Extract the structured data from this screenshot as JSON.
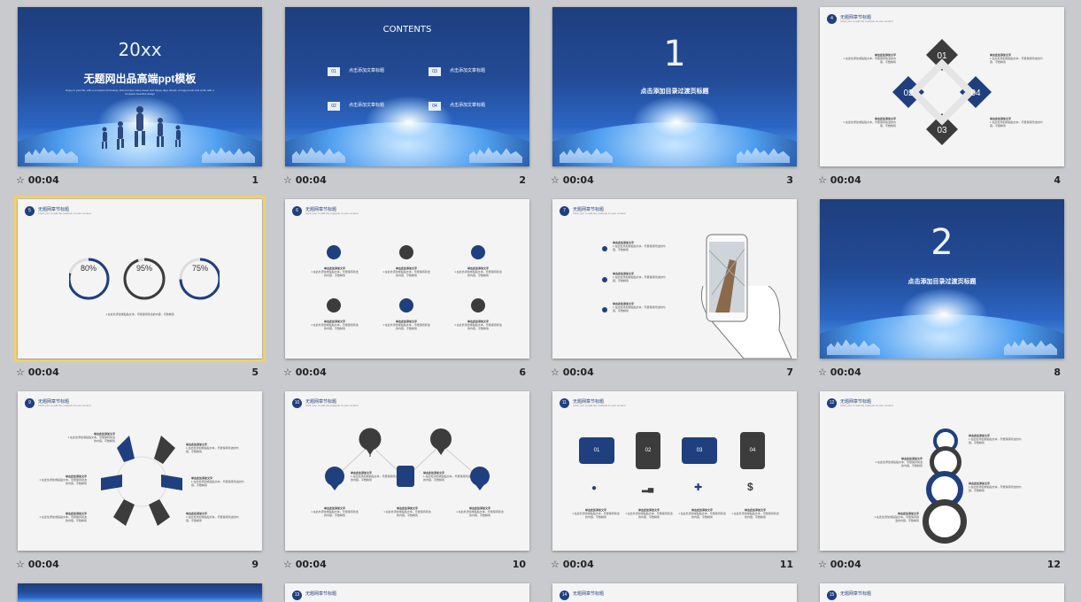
{
  "slides": [
    {
      "number": "1",
      "duration": "00:04",
      "year": "20xx",
      "title": "无题网出品高端ppt模板",
      "body": "Enjoy in your life, with a complete full beauty, that promise many sweet and happy days ahead, a happy heart and smile with a complete beautiful design"
    },
    {
      "number": "2",
      "duration": "00:04",
      "title": "CONTENTS",
      "items": [
        {
          "num": "01",
          "label": "点击添加文章标题"
        },
        {
          "num": "02",
          "label": "点击添加文章标题"
        },
        {
          "num": "03",
          "label": "点击添加文章标题"
        },
        {
          "num": "04",
          "label": "点击添加文章标题"
        }
      ]
    },
    {
      "number": "3",
      "duration": "00:04",
      "big": "1",
      "title": "点击添加目录过渡页标题"
    },
    {
      "number": "4",
      "duration": "00:04",
      "header": "无题网章节标题",
      "labels": [
        "01",
        "02",
        "03",
        "04"
      ]
    },
    {
      "number": "5",
      "duration": "00:04",
      "header": "无题网章节标题",
      "pct": [
        "80%",
        "95%",
        "75%"
      ]
    },
    {
      "number": "6",
      "duration": "00:04",
      "header": "无题网章节标题"
    },
    {
      "number": "7",
      "duration": "00:04",
      "header": "无题网章节标题"
    },
    {
      "number": "8",
      "duration": "00:04",
      "big": "2",
      "title": "点击添加目录过渡页标题"
    },
    {
      "number": "9",
      "duration": "00:04",
      "header": "无题网章节标题"
    },
    {
      "number": "10",
      "duration": "00:04",
      "header": "无题网章节标题"
    },
    {
      "number": "11",
      "duration": "00:04",
      "header": "无题网章节标题",
      "pieces": [
        "01",
        "02",
        "03",
        "04"
      ],
      "currency": "$"
    },
    {
      "number": "12",
      "duration": "00:04",
      "header": "无题网章节标题"
    },
    {
      "number": "13"
    },
    {
      "number": "14",
      "header": "无题网章节标题"
    },
    {
      "number": "15",
      "header": "无题网章节标题"
    },
    {
      "number": "16",
      "header": "无题网章节标题"
    }
  ],
  "common": {
    "sublabel": "Click your to add the analysis of your content",
    "item_title": "单击此处添加文字",
    "item_body": "1.在此处添加或粘贴文本，尽量保持简洁的内容，字数精简"
  },
  "icons": {
    "timing": "star-timing-icon"
  },
  "colors": {
    "navy": "#1f3f7e",
    "selection": "#f2cf6a",
    "dark_gray": "#3c3c3c"
  }
}
